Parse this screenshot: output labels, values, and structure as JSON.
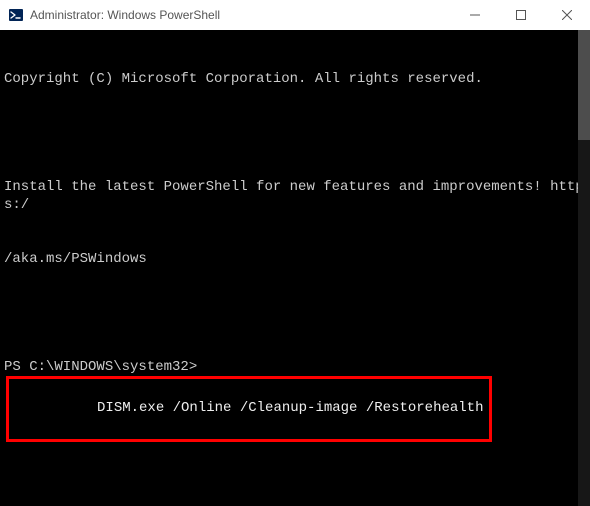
{
  "titlebar": {
    "title": "Administrator: Windows PowerShell"
  },
  "terminal": {
    "copyright": "Copyright (C) Microsoft Corporation. All rights reserved.",
    "install_msg_l1": "Install the latest PowerShell for new features and improvements! https:/",
    "install_msg_l2": "/aka.ms/PSWindows",
    "prompt": "PS C:\\WINDOWS\\system32>",
    "command": "DISM.exe /Online /Cleanup-image /Restorehealth"
  }
}
